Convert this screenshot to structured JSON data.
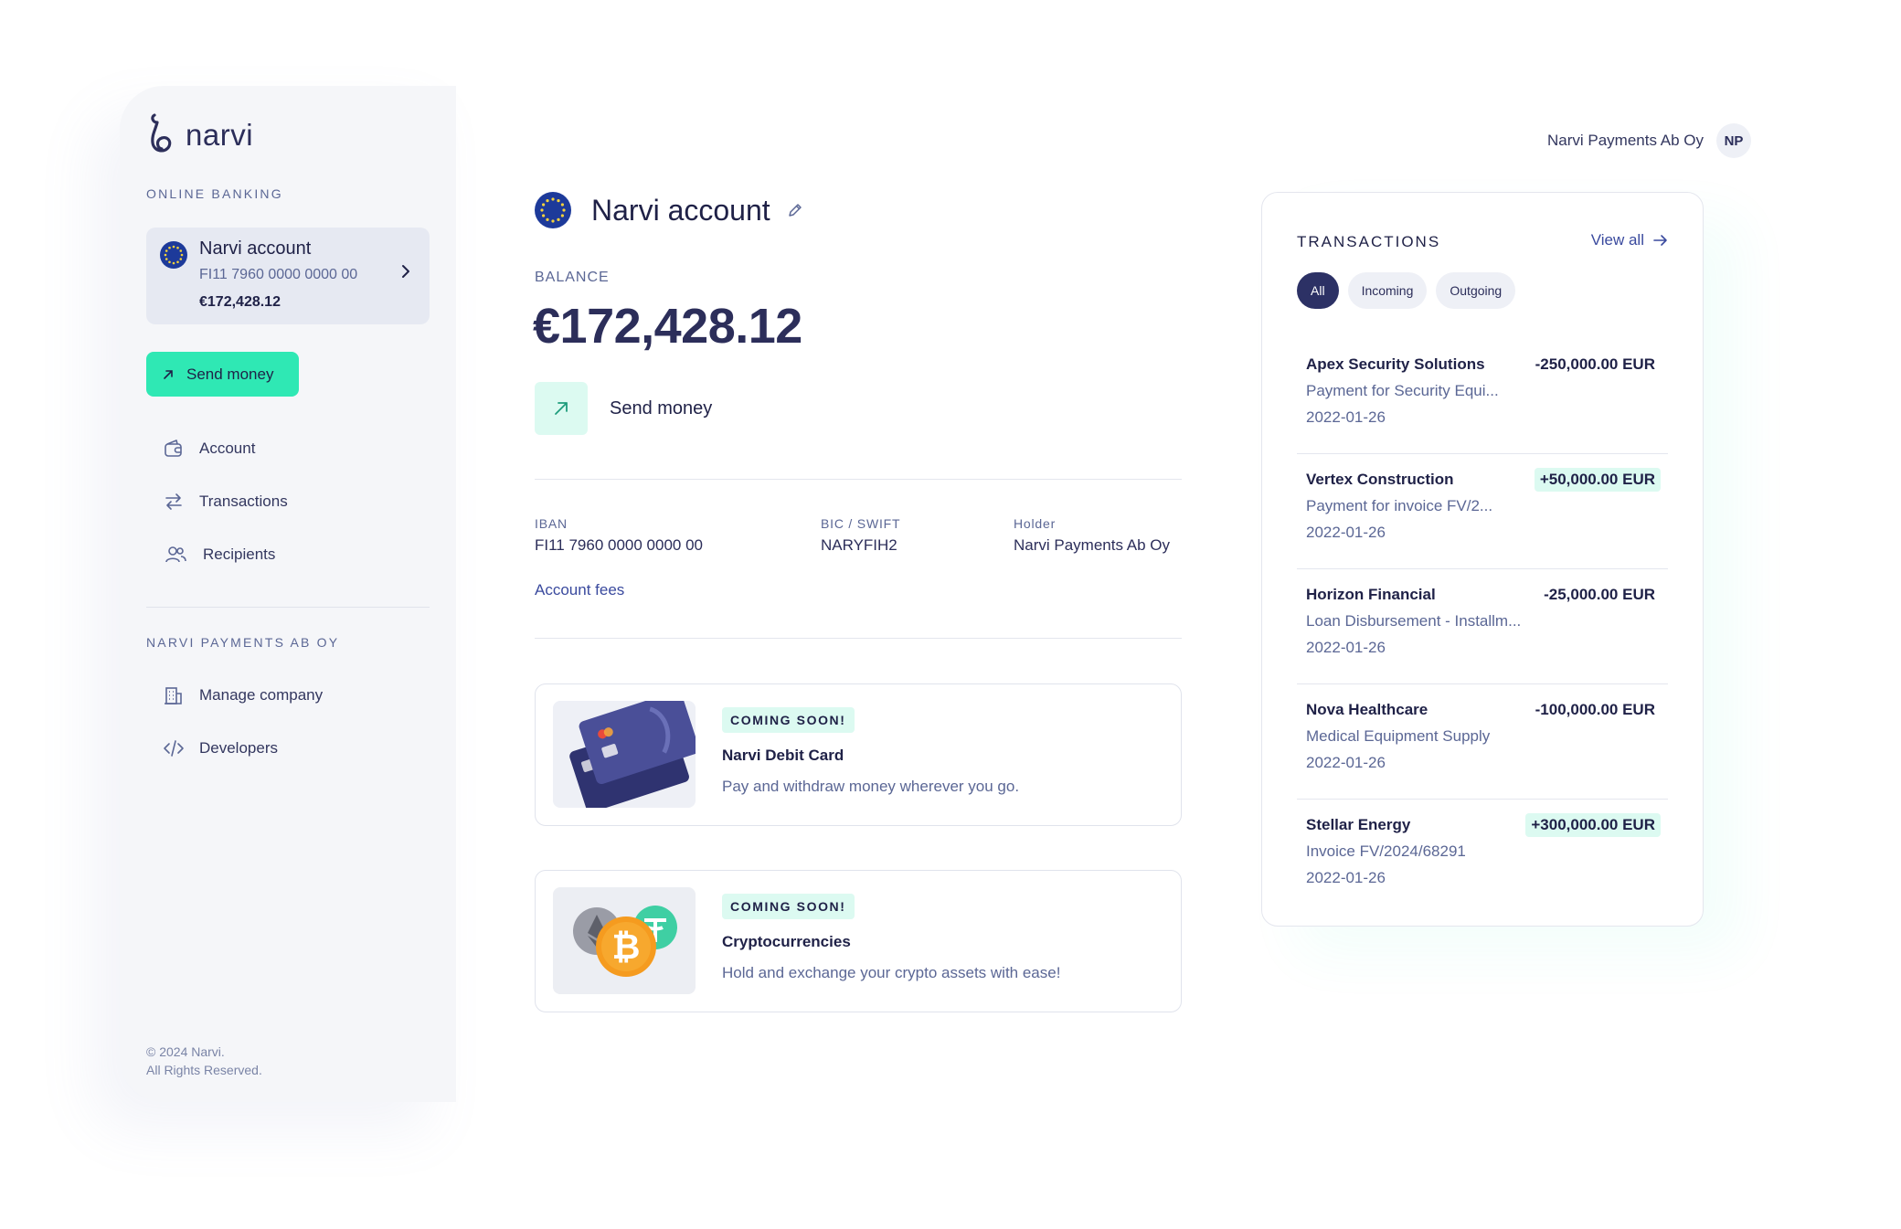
{
  "sidebar": {
    "brand": "narvi",
    "section_online": "ONLINE BANKING",
    "account_card": {
      "name": "Narvi account",
      "iban": "FI11 7960 0000 0000 00",
      "balance": "€172,428.12"
    },
    "send_button": "Send money",
    "nav": [
      {
        "label": "Account",
        "icon": "wallet-icon"
      },
      {
        "label": "Transactions",
        "icon": "transfer-arrows-icon"
      },
      {
        "label": "Recipients",
        "icon": "users-icon"
      }
    ],
    "section_company": "NARVI PAYMENTS AB OY",
    "company_nav": [
      {
        "label": "Manage company",
        "icon": "building-icon"
      },
      {
        "label": "Developers",
        "icon": "code-icon"
      }
    ],
    "footer_line1": "© 2024 Narvi.",
    "footer_line2": "All Rights Reserved."
  },
  "main": {
    "title": "Narvi account",
    "balance_label": "BALANCE",
    "balance": "€172,428.12",
    "send_label": "Send money",
    "details": {
      "iban_label": "IBAN",
      "iban_value": "FI11 7960 0000 0000 00",
      "bic_label": "BIC / SWIFT",
      "bic_value": "NARYFIH2",
      "holder_label": "Holder",
      "holder_value": "Narvi Payments Ab Oy"
    },
    "fees_link": "Account fees",
    "promos": [
      {
        "badge": "COMING SOON!",
        "title": "Narvi Debit Card",
        "desc": "Pay and withdraw money wherever you go."
      },
      {
        "badge": "COMING SOON!",
        "title": "Cryptocurrencies",
        "desc": "Hold and exchange your crypto assets with ease!"
      }
    ]
  },
  "header": {
    "company_name": "Narvi Payments Ab Oy",
    "avatar_initials": "NP"
  },
  "transactions": {
    "heading": "TRANSACTIONS",
    "view_all": "View all",
    "filters": [
      "All",
      "Incoming",
      "Outgoing"
    ],
    "active_filter": "All",
    "items": [
      {
        "name": "Apex Security Solutions",
        "desc": "Payment for Security Equi...",
        "date": "2022-01-26",
        "amount": "-250,000.00 EUR",
        "incoming": false
      },
      {
        "name": "Vertex Construction",
        "desc": "Payment for invoice FV/2...",
        "date": "2022-01-26",
        "amount": "+50,000.00 EUR",
        "incoming": true
      },
      {
        "name": "Horizon Financial",
        "desc": "Loan Disbursement - Installm...",
        "date": "2022-01-26",
        "amount": "-25,000.00 EUR",
        "incoming": false
      },
      {
        "name": "Nova Healthcare",
        "desc": "Medical Equipment Supply",
        "date": "2022-01-26",
        "amount": "-100,000.00 EUR",
        "incoming": false
      },
      {
        "name": "Stellar Energy",
        "desc": "Invoice FV/2024/68291",
        "date": "2022-01-26",
        "amount": "+300,000.00 EUR",
        "incoming": true
      }
    ]
  },
  "colors": {
    "accent": "#2fe8b4",
    "accent_soft": "#dcfaf1",
    "navy": "#2c3165",
    "link": "#3a4a9e"
  }
}
